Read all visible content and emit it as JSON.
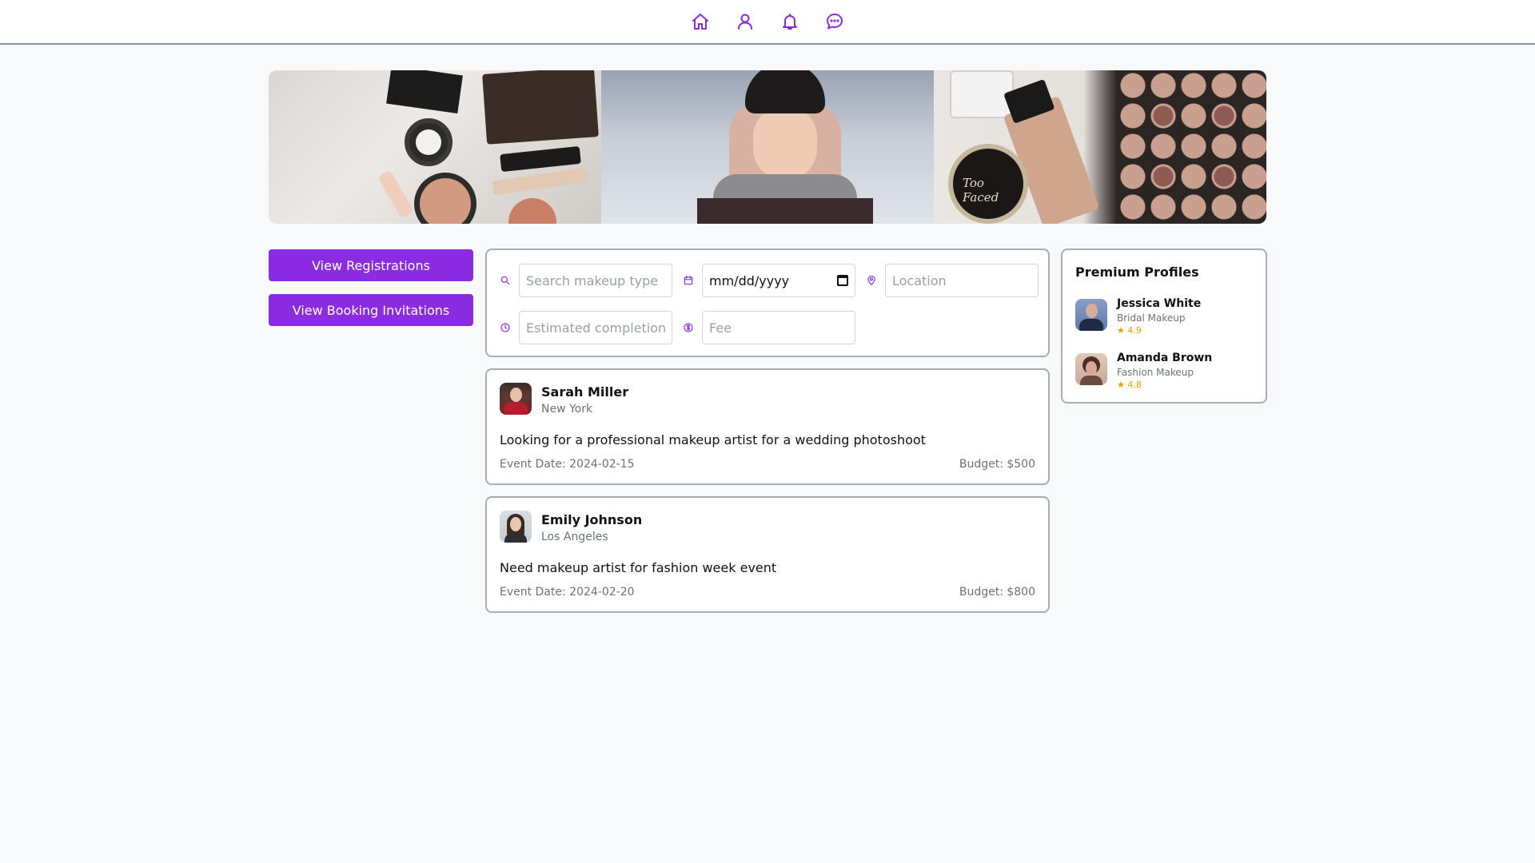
{
  "nav": {
    "icons": [
      "home-icon",
      "user-icon",
      "bell-icon",
      "message-icon"
    ],
    "accent": "#8b2be2"
  },
  "banner": {
    "tiles": [
      "makeup-flatlay-image",
      "portrait-image",
      "eyeshadow-palette-image"
    ],
    "brand_text": "Too Faced"
  },
  "actions": {
    "view_registrations": "View Registrations",
    "view_booking_invitations": "View Booking Invitations"
  },
  "filters": {
    "search_placeholder": "Search makeup type",
    "date_value": "mm/dd/yyyy",
    "location_placeholder": "Location",
    "completion_placeholder": "Estimated completion",
    "fee_placeholder": "Fee"
  },
  "requests": [
    {
      "name": "Sarah Miller",
      "city": "New York",
      "description": "Looking for a professional makeup artist for a wedding photoshoot",
      "event_date": "Event Date: 2024-02-15",
      "budget": "Budget: $500"
    },
    {
      "name": "Emily Johnson",
      "city": "Los Angeles",
      "description": "Need makeup artist for fashion week event",
      "event_date": "Event Date: 2024-02-20",
      "budget": "Budget: $800"
    }
  ],
  "premium": {
    "title": "Premium Profiles",
    "profiles": [
      {
        "name": "Jessica White",
        "specialty": "Bridal Makeup",
        "rating": "★ 4.9"
      },
      {
        "name": "Amanda Brown",
        "specialty": "Fashion Makeup",
        "rating": "★ 4.8"
      }
    ]
  },
  "colors": {
    "primary": "#8b2be2",
    "rating": "#e0a100",
    "muted": "#6b7079",
    "background": "#f8f9fb"
  }
}
